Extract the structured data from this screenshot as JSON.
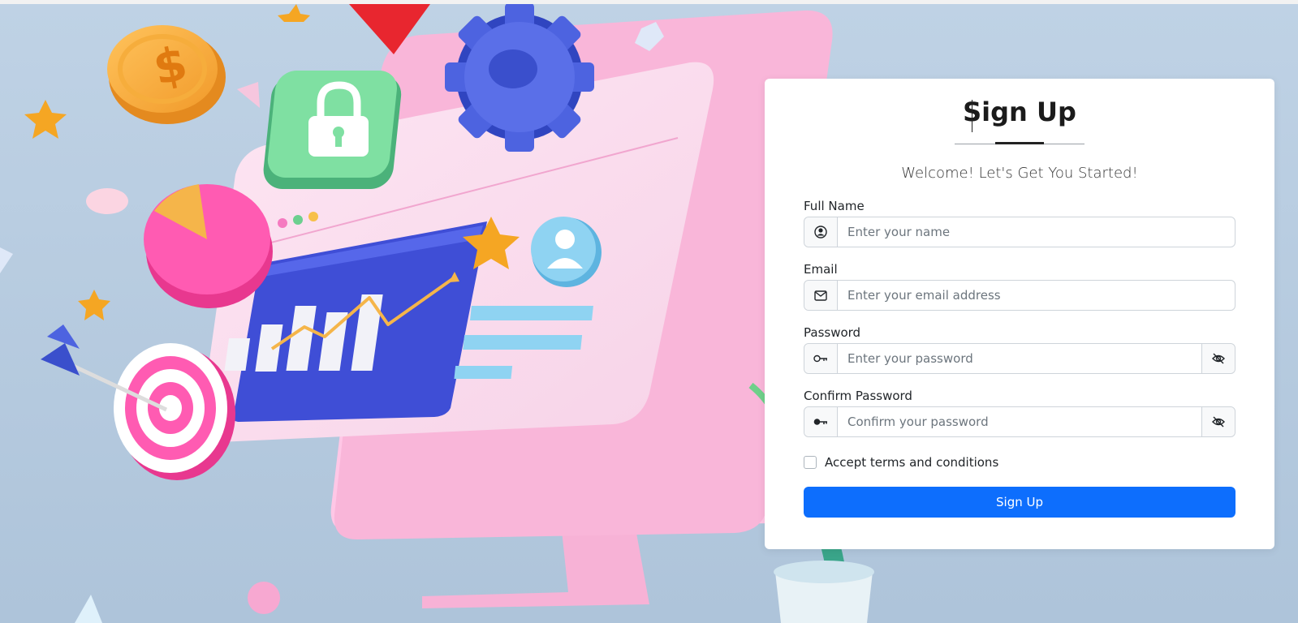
{
  "form": {
    "title": "Sign Up",
    "subtitle": "Welcome! Let's Get You Started!",
    "fields": [
      {
        "label": "Full Name",
        "placeholder": "Enter your name",
        "icon": "user-circle-icon"
      },
      {
        "label": "Email",
        "placeholder": "Enter your email address",
        "icon": "envelope-icon"
      },
      {
        "label": "Password",
        "placeholder": "Enter your password",
        "icon": "key-icon",
        "toggle_icon": "eye-slash-icon"
      },
      {
        "label": "Confirm Password",
        "placeholder": "Confirm your password",
        "icon": "key-fill-icon",
        "toggle_icon": "eye-slash-icon"
      }
    ],
    "terms_label": "Accept terms and conditions",
    "submit_label": "Sign Up",
    "accent_color": "#0d6efd"
  },
  "illustration": {
    "description_icons": [
      "coin-icon",
      "lock-icon",
      "gear-icon",
      "star-icon",
      "pie-chart-icon",
      "target-icon",
      "monitor-icon",
      "user-avatar-icon",
      "bar-chart-icon"
    ]
  }
}
